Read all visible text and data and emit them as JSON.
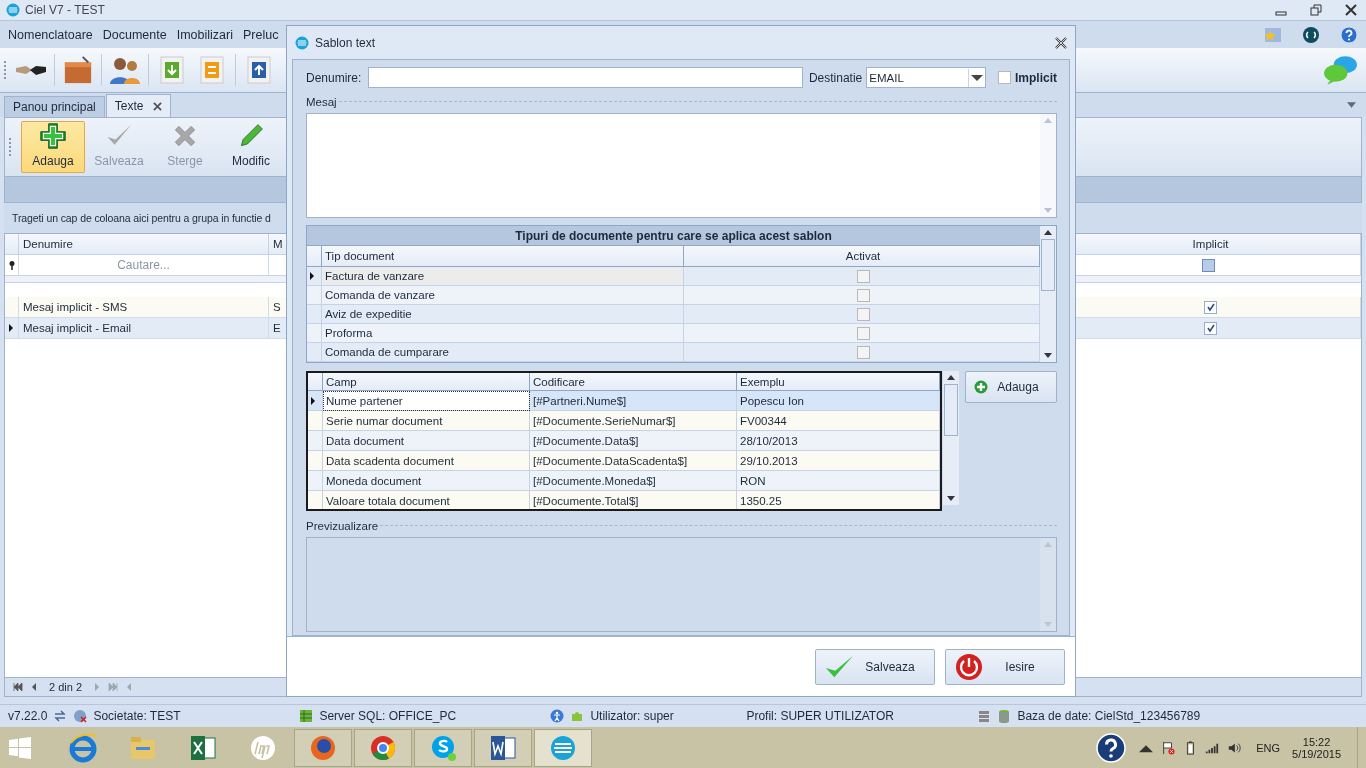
{
  "window": {
    "title": "Ciel V7 - TEST"
  },
  "menu": [
    "Nomenclatoare",
    "Documente",
    "Imobilizari",
    "Preluc"
  ],
  "tabs": [
    {
      "label": "Panou principal",
      "selected": false,
      "closable": false
    },
    {
      "label": "Texte",
      "selected": true,
      "closable": true
    }
  ],
  "ribbon": [
    {
      "label": "Adauga",
      "kind": "add",
      "highlighted": true,
      "disabled": false
    },
    {
      "label": "Salveaza",
      "kind": "save",
      "highlighted": false,
      "disabled": true
    },
    {
      "label": "Sterge",
      "kind": "delete",
      "highlighted": false,
      "disabled": true
    },
    {
      "label": "Modific",
      "kind": "edit",
      "highlighted": false,
      "disabled": false
    }
  ],
  "group_panel": {
    "hint": "Trageti un cap de coloana aici pentru a grupa in functie d"
  },
  "grid": {
    "columns": [
      "Denumire",
      "M",
      "Implicit"
    ],
    "filter": {
      "placeholder": "Cautare...",
      "implicit_indeterminate": true
    },
    "rows": [
      {
        "cells": [
          "Mesaj implicit - SMS",
          "S"
        ],
        "implicit": true,
        "selected": false
      },
      {
        "cells": [
          "Mesaj implicit - Email",
          "E"
        ],
        "implicit": true,
        "selected": true
      }
    ]
  },
  "navigator": {
    "position": "2 din 2"
  },
  "status_bar": {
    "version": "v7.22.0",
    "company": "Societate: TEST",
    "server": "Server SQL: OFFICE_PC",
    "user": "Utilizator: super",
    "profile": "Profil: SUPER UTILIZATOR",
    "database": "Baza de date: CielStd_123456789"
  },
  "dialog": {
    "title": "Sablon text",
    "name_label": "Denumire:",
    "destination_label": "Destinatie",
    "destination": "EMAIL",
    "default_label": "Implicit",
    "default_checked": false,
    "message_label": "Mesaj",
    "doc_types": {
      "title": "Tipuri de documente pentru care se aplica acest sablon",
      "columns": [
        "Tip document",
        "Activat"
      ],
      "rows": [
        {
          "name": "Factura de vanzare",
          "activated": false,
          "selected": true
        },
        {
          "name": "Comanda de vanzare",
          "activated": false,
          "selected": false
        },
        {
          "name": "Aviz de expeditie",
          "activated": false,
          "selected": false
        },
        {
          "name": "Proforma",
          "activated": false,
          "selected": false
        },
        {
          "name": "Comanda de cumparare",
          "activated": false,
          "selected": false
        }
      ]
    },
    "fields": {
      "columns": [
        "Camp",
        "Codificare",
        "Exemplu"
      ],
      "rows": [
        {
          "cells": [
            "Nume partener",
            "[#Partneri.Nume$]",
            "Popescu Ion"
          ],
          "selected": true
        },
        {
          "cells": [
            "Serie numar document",
            "[#Documente.SerieNumar$]",
            "FV00344"
          ],
          "selected": false
        },
        {
          "cells": [
            "Data document",
            "[#Documente.Data$]",
            "28/10/2013"
          ],
          "selected": false
        },
        {
          "cells": [
            "Data scadenta document",
            "[#Documente.DataScadenta$]",
            "29/10.2013"
          ],
          "selected": false
        },
        {
          "cells": [
            "Moneda document",
            "[#Documente.Moneda$]",
            "RON"
          ],
          "selected": false
        },
        {
          "cells": [
            "Valoare totala document",
            "[#Documente.Total$]",
            "1350.25"
          ],
          "selected": false
        }
      ]
    },
    "add_button": "Adauga",
    "preview_label": "Previzualizare",
    "buttons": [
      {
        "label": "Salveaza",
        "kind": "save"
      },
      {
        "label": "Iesire",
        "kind": "exit"
      }
    ]
  },
  "taskbar": {
    "apps": [
      {
        "kind": "ie",
        "running": false,
        "active": false
      },
      {
        "kind": "explorer",
        "running": false,
        "active": false
      },
      {
        "kind": "excel",
        "running": false,
        "active": false
      },
      {
        "kind": "hp",
        "running": false,
        "active": false
      },
      {
        "kind": "firefox",
        "running": true,
        "active": false
      },
      {
        "kind": "chrome",
        "running": true,
        "active": false
      },
      {
        "kind": "skype",
        "running": true,
        "active": false
      },
      {
        "kind": "word",
        "running": true,
        "active": false
      },
      {
        "kind": "ciel",
        "running": true,
        "active": true
      }
    ],
    "language": "ENG",
    "time": "15:22",
    "date": "5/19/2015"
  }
}
